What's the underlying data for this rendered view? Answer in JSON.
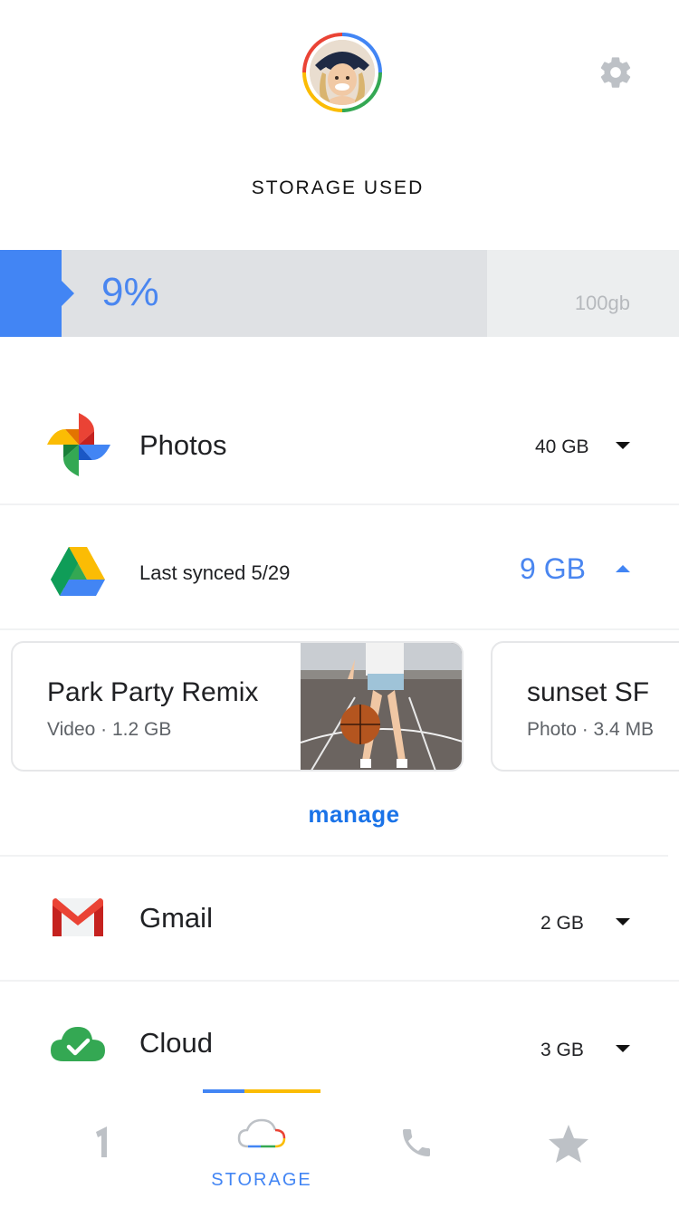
{
  "header": {
    "avatar_alt": "profile photo",
    "settings_icon": "gear-icon"
  },
  "storage": {
    "title": "STORAGE USED",
    "percent_label": "9%",
    "percent_value": 0.09,
    "capacity_label": "100gb",
    "accent": "#4285f4"
  },
  "services": [
    {
      "name": "Photos",
      "size": "40 GB",
      "icon": "google-photos-icon",
      "expanded": false
    },
    {
      "name": "Last synced 5/29",
      "size": "9 GB",
      "icon": "google-drive-icon",
      "expanded": true
    },
    {
      "name": "Gmail",
      "size": "2 GB",
      "icon": "gmail-icon",
      "expanded": false
    },
    {
      "name": "Cloud",
      "size": "3 GB",
      "icon": "cloud-check-icon",
      "expanded": false
    }
  ],
  "drive_files": [
    {
      "title": "Park Party Remix",
      "subtitle": "Video · 1.2 GB"
    },
    {
      "title": "sunset SF",
      "subtitle": "Photo · 3.4 MB"
    }
  ],
  "manage_label": "manage",
  "tabs": [
    {
      "name": "home",
      "icon": "one-logo-icon",
      "label": ""
    },
    {
      "name": "storage",
      "icon": "cloud-icon",
      "label": "STORAGE",
      "active": true
    },
    {
      "name": "phone",
      "icon": "phone-icon",
      "label": ""
    },
    {
      "name": "favorites",
      "icon": "star-icon",
      "label": ""
    }
  ]
}
